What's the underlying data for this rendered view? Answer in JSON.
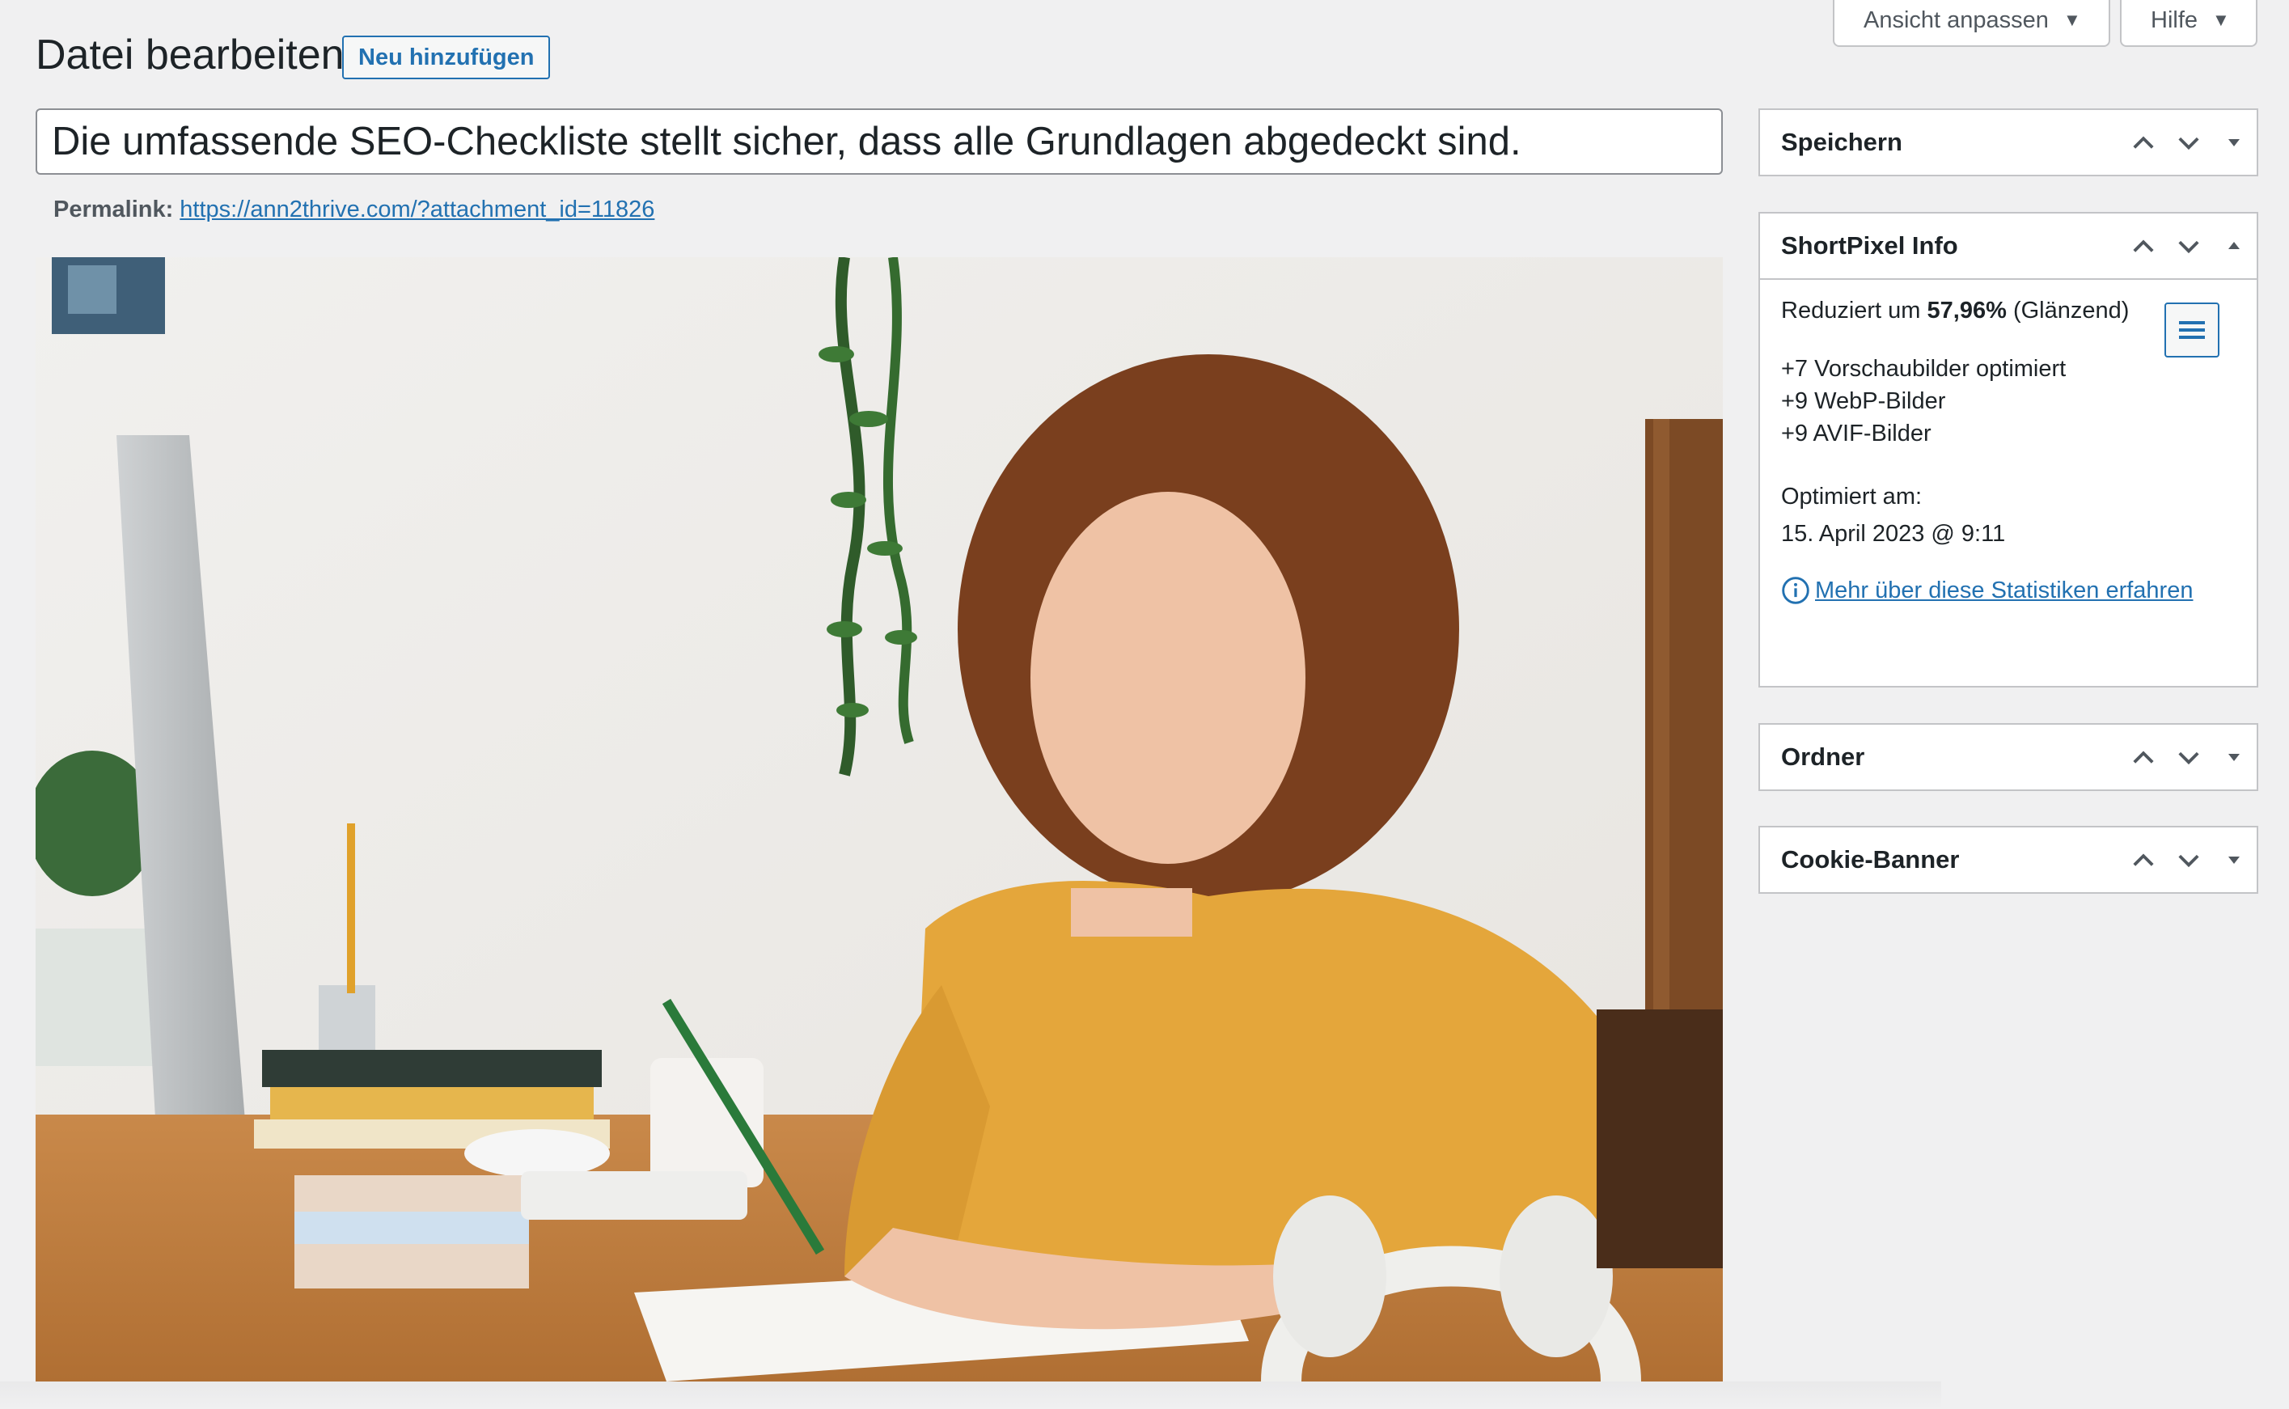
{
  "header": {
    "title": "Datei bearbeiten",
    "add_new": "Neu hinzufügen",
    "screen_options": "Ansicht anpassen",
    "help": "Hilfe",
    "caret": "▼"
  },
  "editor": {
    "title_value": "Die umfassende SEO-Checkliste stellt sicher, dass alle Grundlagen abgedeckt sind.",
    "permalink_label": "Permalink:",
    "permalink_url": "https://ann2thrive.com/?attachment_id=11826"
  },
  "sidebar": {
    "save_title": "Speichern",
    "shortpixel": {
      "title": "ShortPixel Info",
      "reduced_prefix": "Reduziert um",
      "reduced_value": "57,96%",
      "reduced_suffix": "(Glänzend)",
      "line_thumbs": "+7 Vorschaubilder optimiert",
      "line_webp": "+9 WebP-Bilder",
      "line_avif": "+9 AVIF-Bilder",
      "optimized_label": "Optimiert am:",
      "optimized_date": "15. April 2023 @ 9:11",
      "stats_link": "Mehr über diese Statistiken erfahren"
    },
    "folder_title": "Ordner",
    "cookie_title": "Cookie-Banner"
  },
  "colors": {
    "accent": "#2271b1",
    "background": "#f0f0f1",
    "border": "#c3c4c7"
  },
  "icons": [
    "caret-down-icon",
    "chevron-up-icon",
    "chevron-down-icon",
    "toggle-arrow-icon",
    "menu-icon",
    "info-icon"
  ]
}
